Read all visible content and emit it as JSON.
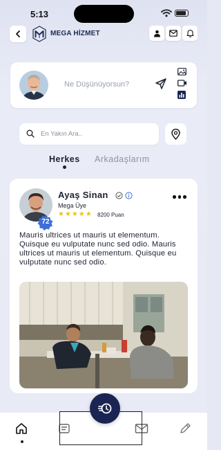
{
  "status": {
    "time": "5:13"
  },
  "topbar": {
    "brand": "MEGA HİZMET"
  },
  "composer": {
    "placeholder": "Ne Düşünüyorsun?"
  },
  "search": {
    "placeholder": "En Yakın Ara.."
  },
  "tabs": [
    {
      "label": "Herkes",
      "active": true
    },
    {
      "label": "Arkadaşlarım",
      "active": false
    }
  ],
  "post": {
    "author": "Ayaş Sinan",
    "role": "Mega Üye",
    "rating": 5,
    "points": "8200 Puan",
    "level": "72",
    "text": "Mauris ultrices ut mauris ut elementum. Quisque eu vulputate nunc sed odio. Mauris ultrices ut mauris ut elementum. Quisque eu vulputate nunc sed odio."
  },
  "colors": {
    "navy": "#1a2553",
    "accent_blue": "#3d6fd8",
    "star": "#f5c400"
  }
}
